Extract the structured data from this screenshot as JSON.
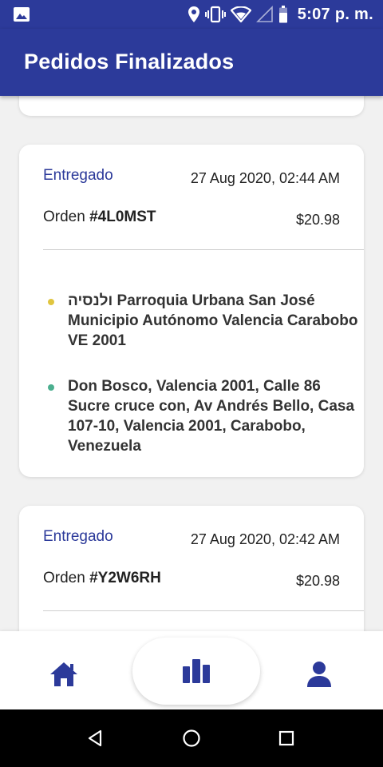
{
  "status_bar": {
    "time": "5:07 p. m.",
    "icons": [
      "image-icon",
      "location-icon",
      "vibrate-icon",
      "wifi-icon",
      "signal-icon",
      "battery-icon"
    ]
  },
  "app_bar": {
    "title": "Pedidos Finalizados"
  },
  "orders": [
    {
      "status": "Entregado",
      "date": "27 Aug 2020, 02:44 AM",
      "order_label": "Orden",
      "order_code": "#4L0MST",
      "price": "$20.98",
      "pickup_address": "ולנסיה Parroquia Urbana San José Municipio Autónomo Valencia Carabobo VE 2001",
      "dropoff_address": "Don Bosco, Valencia 2001, Calle 86 Sucre cruce con, Av Andrés Bello, Casa 107-10, Valencia 2001, Carabobo, Venezuela"
    },
    {
      "status": "Entregado",
      "date": "27 Aug 2020, 02:42 AM",
      "order_label": "Orden",
      "order_code": "#Y2W6RH",
      "price": "$20.98"
    }
  ],
  "bottom_nav": {
    "items": [
      "home-icon",
      "stats-icon",
      "profile-icon"
    ]
  },
  "colors": {
    "primary": "#2c3a9a",
    "pickup_dot": "#e0c53f",
    "dropoff_dot": "#4caf8f",
    "background": "#f1f1f1"
  }
}
